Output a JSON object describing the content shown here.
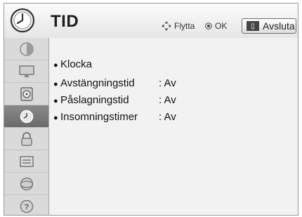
{
  "header": {
    "title": "TID",
    "hint_move": "Flytta",
    "hint_ok": "OK",
    "exit_label": "Avsluta"
  },
  "sidebar": {
    "items": [
      {
        "icon": "picture-icon"
      },
      {
        "icon": "monitor-icon"
      },
      {
        "icon": "speaker-icon"
      },
      {
        "icon": "clock-icon",
        "active": true
      },
      {
        "icon": "lock-icon"
      },
      {
        "icon": "options-icon"
      },
      {
        "icon": "network-icon"
      },
      {
        "icon": "help-icon"
      }
    ]
  },
  "menu": {
    "items": [
      {
        "label": "Klocka",
        "value": ""
      },
      {
        "label": "Avstängningstid",
        "value": ": Av"
      },
      {
        "label": "Påslagningstid",
        "value": ": Av"
      },
      {
        "label": "Insomningstimer",
        "value": ": Av"
      }
    ]
  }
}
